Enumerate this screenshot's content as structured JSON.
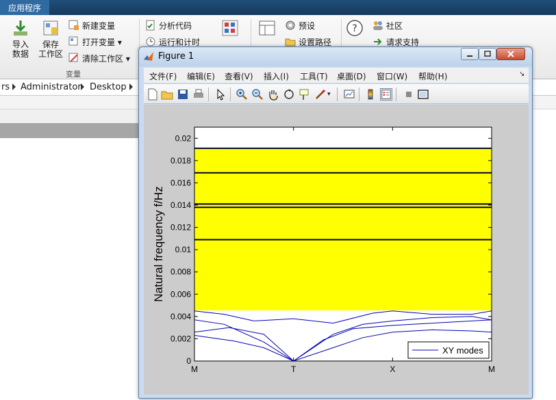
{
  "app": {
    "tab_label": "应用程序"
  },
  "ribbon": {
    "import": "导入\n数据",
    "save_workspace": "保存\n工作区",
    "new_variable": "新建变量",
    "open_variable": "打开变量",
    "clear_workspace": "清除工作区",
    "group_variable": "变量",
    "analyze_code": "分析代码",
    "run_and_time": "运行和计时",
    "preferences": "预设",
    "set_path": "设置路径",
    "community": "社区",
    "request_support": "请求支持"
  },
  "breadcrumb": [
    "rs",
    "Administrator",
    "Desktop"
  ],
  "figure": {
    "title": "Figure 1",
    "menu": [
      "文件(F)",
      "编辑(E)",
      "查看(V)",
      "插入(I)",
      "工具(T)",
      "桌面(D)",
      "窗口(W)",
      "帮助(H)"
    ],
    "toolbar_icons": [
      "new-figure-icon",
      "open-icon",
      "save-icon",
      "print-icon",
      "select-arrow-icon",
      "zoom-in-icon",
      "zoom-out-icon",
      "pan-hand-icon",
      "rotate-3d-icon",
      "data-cursor-icon",
      "brush-icon",
      "link-plot-icon",
      "colorbar-icon",
      "legend-icon",
      "hide-plot-tools-icon",
      "show-plot-tools-icon"
    ]
  },
  "colors": {
    "band_fill": "#ffff00",
    "curve": "#0000b4",
    "canvas_bg": "#cccccc"
  },
  "chart_data": {
    "type": "line",
    "xlabel": "",
    "ylabel": "Natural frequency f/Hz",
    "xticks": [
      "M",
      "T",
      "X",
      "M"
    ],
    "yticks": [
      "0",
      "0.002",
      "0.004",
      "0.006",
      "0.008",
      "0.01",
      "0.012",
      "0.014",
      "0.016",
      "0.018",
      "0.02"
    ],
    "ylim": [
      0,
      0.021
    ],
    "xlim": [
      0,
      3
    ],
    "grid": false,
    "legend": {
      "entries": [
        "XY modes"
      ],
      "position": "bottom-right"
    },
    "bands": [
      {
        "y0": 0.00455,
        "y1": 0.0191,
        "color": "#ffff00"
      }
    ],
    "series": [
      {
        "x": [
          0,
          0.3,
          0.6,
          1,
          1.4,
          1.8,
          2,
          2.4,
          2.8,
          3
        ],
        "y": [
          0.0045,
          0.0042,
          0.0036,
          0.0038,
          0.0034,
          0.0043,
          0.0045,
          0.0042,
          0.0042,
          0.0045
        ]
      },
      {
        "x": [
          0,
          0.35,
          0.7,
          1,
          1.4,
          1.7,
          2,
          2.4,
          2.8,
          3
        ],
        "y": [
          0.0026,
          0.003,
          0.0024,
          0,
          0.0024,
          0.0033,
          0.0036,
          0.0039,
          0.004,
          0.0037
        ]
      },
      {
        "x": [
          0,
          0.4,
          0.7,
          1,
          1.4,
          1.7,
          2,
          2.4,
          2.8,
          3
        ],
        "y": [
          0.0023,
          0.0018,
          0.0012,
          0,
          0.0012,
          0.0021,
          0.0026,
          0.0028,
          0.0027,
          0.0026
        ]
      },
      {
        "x": [
          0,
          0.3,
          0.7,
          1,
          1.3,
          1.6,
          2,
          2.4,
          2.8,
          3
        ],
        "y": [
          0.0037,
          0.0033,
          0.0017,
          0,
          0.0019,
          0.0029,
          0.0032,
          0.0034,
          0.0036,
          0.0037
        ]
      },
      {
        "x": [
          0,
          0.5,
          1,
          1.5,
          2,
          2.5,
          3
        ],
        "y": [
          0.0109,
          0.0109,
          0.0109,
          0.0109,
          0.0109,
          0.0109,
          0.0109
        ]
      },
      {
        "x": [
          0,
          0.5,
          1,
          1.5,
          2,
          2.5,
          3
        ],
        "y": [
          0.0138,
          0.0138,
          0.0138,
          0.0138,
          0.0138,
          0.0138,
          0.0138
        ]
      },
      {
        "x": [
          0,
          0.5,
          1,
          1.5,
          2,
          2.5,
          3
        ],
        "y": [
          0.0141,
          0.0141,
          0.0141,
          0.0141,
          0.0141,
          0.0141,
          0.0141
        ]
      },
      {
        "x": [
          0,
          0.5,
          1,
          1.5,
          2,
          2.5,
          3
        ],
        "y": [
          0.0169,
          0.0169,
          0.0169,
          0.0169,
          0.0169,
          0.0169,
          0.0169
        ]
      },
      {
        "x": [
          0,
          0.5,
          1,
          1.5,
          2,
          2.5,
          3
        ],
        "y": [
          0.0191,
          0.0191,
          0.0191,
          0.0191,
          0.0191,
          0.0191,
          0.0191
        ]
      }
    ]
  }
}
